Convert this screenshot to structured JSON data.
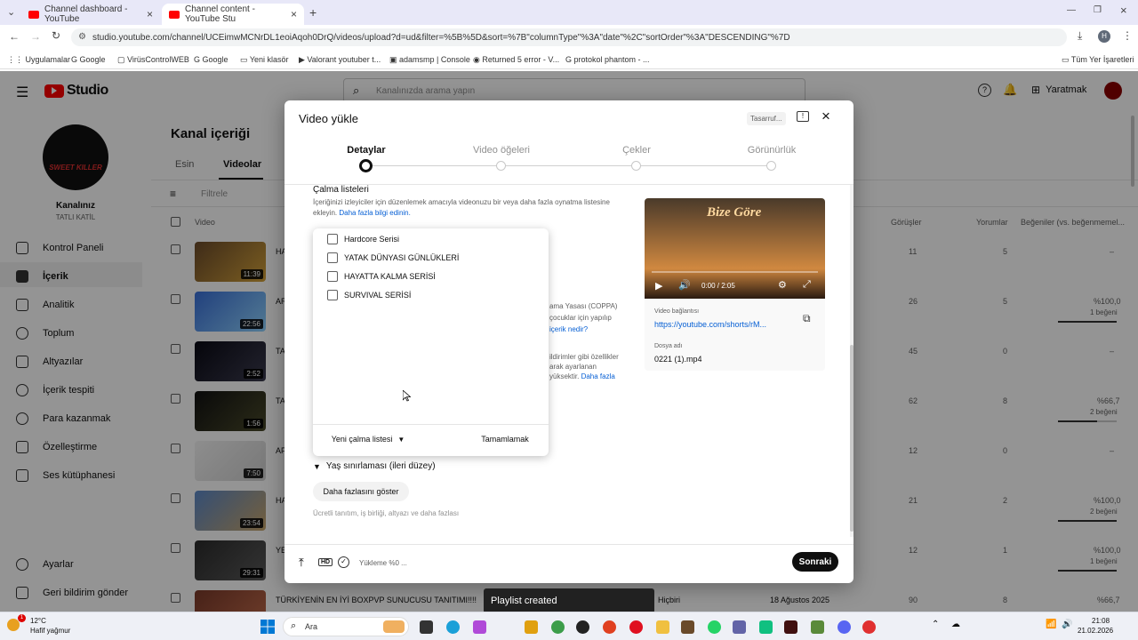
{
  "browser": {
    "tabs": [
      {
        "title": "Channel dashboard - YouTube"
      },
      {
        "title": "Channel content - YouTube Stu"
      }
    ],
    "url": "studio.youtube.com/channel/UCEimwMCNrDL1eoiAqoh0DrQ/videos/upload?d=ud&filter=%5B%5D&sort=%7B\"columnType\"%3A\"date\"%2C\"sortOrder\"%3A\"DESCENDING\"%7D",
    "profile_initial": "H",
    "bookmarks": [
      "Uygulamalar",
      "Google",
      "VirüsControlWEB",
      "Google",
      "Yeni klasör",
      "Valorant youtuber t...",
      "adamsmp | Console",
      "Returned 5 error - V...",
      "protokol phantom - ...",
      "Tüm Yer İşaretleri"
    ]
  },
  "studio": {
    "logo": "Studio",
    "search_placeholder": "Kanalınızda arama yapın",
    "create_label": "Yaratmak",
    "channel_label": "Kanalınız",
    "channel_name": "TATLI KATİL",
    "avatar_text": "SWEET KILLER",
    "page_title": "Kanal içeriği",
    "tabs": [
      "Esin",
      "Videolar"
    ],
    "filter_label": "Filtrele",
    "col_video": "Video",
    "col_views": "Görüşler",
    "col_comments": "Yorumlar",
    "col_likes": "Beğeniler (vs. beğenmemel...",
    "nav": [
      "Kontrol Paneli",
      "İçerik",
      "Analitik",
      "Toplum",
      "Altyazılar",
      "İçerik tespiti",
      "Para kazanmak",
      "Özelleştirme",
      "Ses kütüphanesi"
    ],
    "nav_bottom": [
      "Ayarlar",
      "Geri bildirim gönder"
    ],
    "rows": [
      {
        "duration": "11:39",
        "title": "HA",
        "views": "11",
        "comments": "5",
        "likes": "–",
        "likes_sub": "",
        "likes_fill": 0
      },
      {
        "duration": "22:56",
        "title": "AR",
        "views": "26",
        "comments": "5",
        "likes": "%100,0",
        "likes_sub": "1 beğeni",
        "likes_fill": 1.0
      },
      {
        "duration": "2:52",
        "title": "TA",
        "views": "45",
        "comments": "0",
        "likes": "–",
        "likes_sub": "",
        "likes_fill": 0
      },
      {
        "duration": "1:56",
        "title": "TA",
        "views": "62",
        "comments": "8",
        "likes": "%66,7",
        "likes_sub": "2 beğeni",
        "likes_fill": 0.667
      },
      {
        "duration": "7:50",
        "title": "AF",
        "views": "12",
        "comments": "0",
        "likes": "–",
        "likes_sub": "",
        "likes_fill": 0
      },
      {
        "duration": "23:54",
        "title": "HA",
        "views": "21",
        "comments": "2",
        "likes": "%100,0",
        "likes_sub": "2 beğeni",
        "likes_fill": 1.0
      },
      {
        "duration": "29:31",
        "title": "YE",
        "views": "12",
        "comments": "1",
        "likes": "%100,0",
        "likes_sub": "1 beğeni",
        "likes_fill": 1.0
      },
      {
        "duration": "",
        "title": "TÜRKİYENİN EN İYİ BOXPVP SUNUCUSU TANITIMI!!!!",
        "visibility": "Hiçbiri",
        "date": "18 Ağustos 2025",
        "views": "90",
        "comments": "8",
        "likes": "%66,7",
        "likes_sub": "",
        "likes_fill": 0.667
      }
    ]
  },
  "modal": {
    "title": "Video yükle",
    "save_badge": "Tasarruf...",
    "steps": [
      "Detaylar",
      "Video öğeleri",
      "Çekler",
      "Görünürlük"
    ],
    "playlists_heading": "Çalma listeleri",
    "playlists_desc": "İçeriğinizi izleyiciler için düzenlemek amacıyla videonuzu bir veya daha fazla oynatma listesine ekleyin.",
    "playlists_link": "Daha fazla bilgi edinin.",
    "coppa_text_1": "ama Yasası (COPPA)",
    "coppa_text_2": "çocuklar için yapılıp",
    "coppa_link": "içerik nedir?",
    "features_text_1": "ildirimler gibi özellikler",
    "features_text_2": "arak ayarlanan",
    "features_text_3": "yüksektir.",
    "features_link": "Daha fazla",
    "age_restriction": "Yaş sınırlaması (ileri düzey)",
    "show_more": "Daha fazlasını göster",
    "show_more_desc": "Ücretli tanıtım, iş birliği, altyazı ve daha fazlası",
    "upload_status": "Yükleme %0 ...",
    "next_button": "Sonraki",
    "video_time": "0:00 / 2:05",
    "video_link_label": "Video bağlantısı",
    "video_link": "https://youtube.com/shorts/rM...",
    "filename_label": "Dosya adı",
    "filename": "0221 (1).mp4",
    "thumbnail_title": "Bize Göre"
  },
  "playlist_popup": {
    "options": [
      "Hardcore Serisi",
      "YATAK DÜNYASI GÜNLÜKLERİ",
      "HAYATTA KALMA SERİSİ",
      "SURVIVAL SERİSİ"
    ],
    "new_playlist": "Yeni çalma listesi",
    "done": "Tamamlamak"
  },
  "toast": "Playlist created",
  "taskbar": {
    "weather_temp": "12°C",
    "weather_desc": "Hafif yağmur",
    "search": "Ara",
    "time": "21:08",
    "date": "21.02.2026"
  }
}
